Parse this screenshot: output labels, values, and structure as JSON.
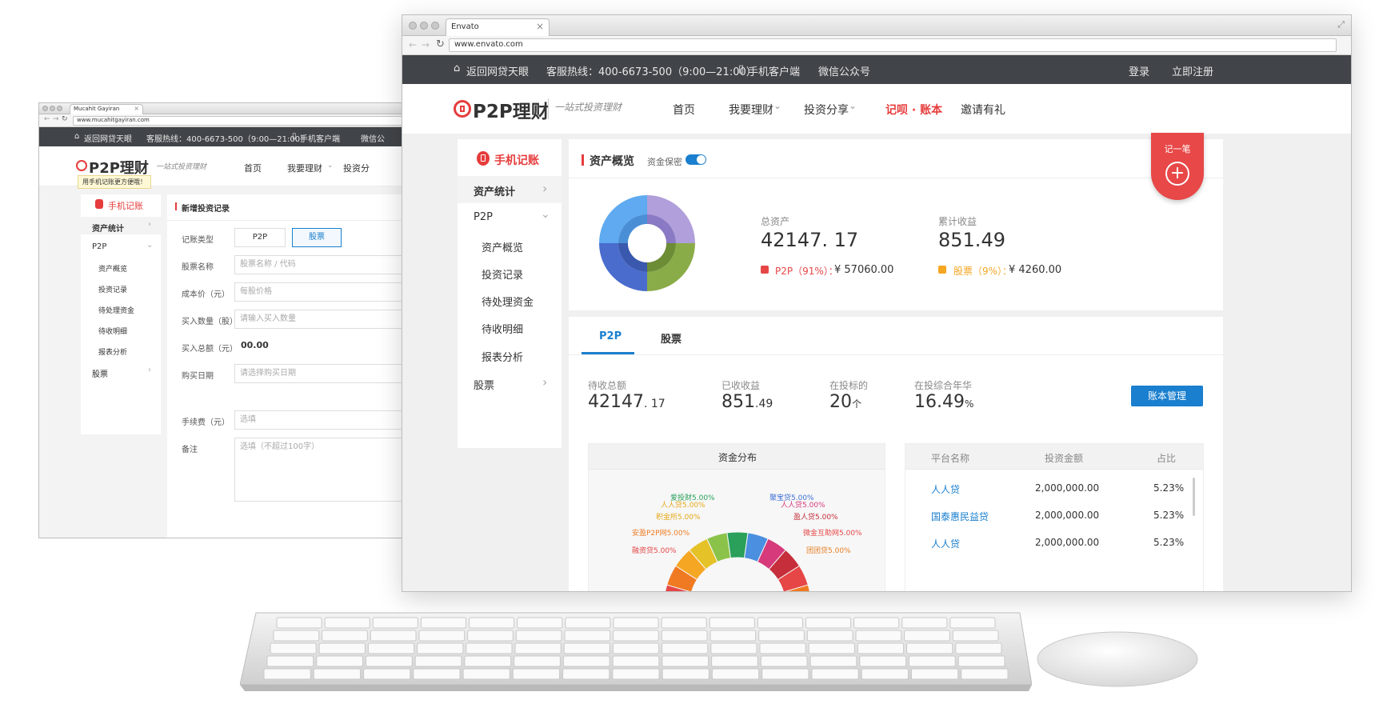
{
  "back_browser": {
    "tab_title": "Mucahit Gayiran",
    "url": "www.mucahitgayiran.com",
    "topnav": {
      "home": "返回网贷天眼",
      "hotline": "客服热线：400-6673-500（9:00—21:00）",
      "mobile": "手机客户端",
      "wechat": "微信公"
    },
    "header": {
      "logo": "P2P理财",
      "slogan": "一站式投资理财",
      "nav": [
        "首页",
        "我要理财",
        "投资分"
      ]
    },
    "tooltip": "用手机记账更方便哦！",
    "sidebar": {
      "brand": "手机记账",
      "items": [
        "资产统计",
        "P2P",
        "资产概览",
        "投资记录",
        "待处理资金",
        "待收明细",
        "报表分析",
        "股票"
      ]
    },
    "form": {
      "title": "新增投资记录",
      "type_label": "记账类型",
      "type_options": [
        "P2P",
        "股票"
      ],
      "name_label": "股票名称",
      "name_placeholder": "股票名称 / 代码",
      "cost_label": "成本价（元）",
      "cost_placeholder": "每股价格",
      "qty_label": "买入数量（股）",
      "qty_placeholder": "请输入买入数量",
      "total_label": "买入总额（元）",
      "total_value": "00.00",
      "date_label": "购买日期",
      "date_placeholder": "请选择购买日期",
      "fee_label": "手续费（元）",
      "fee_placeholder": "选填",
      "note_label": "备注",
      "note_placeholder": "选填（不超过100字）"
    }
  },
  "front_browser": {
    "tab_title": "Envato",
    "url": "www.envato.com",
    "topnav": {
      "home": "返回网贷天眼",
      "hotline": "客服热线：400-6673-500（9:00—21:00）",
      "mobile": "手机客户端",
      "wechat": "微信公众号",
      "login": "登录",
      "register": "立即注册"
    },
    "header": {
      "logo": "P2P理财",
      "slogan": "一站式投资理财",
      "nav": [
        "首页",
        "我要理财",
        "投资分享",
        "记呗 · 账本",
        "邀请有礼"
      ]
    },
    "sidebar": {
      "brand": "手机记账",
      "items": [
        "资产统计",
        "P2P",
        "资产概览",
        "投资记录",
        "待处理资金",
        "待收明细",
        "报表分析",
        "股票"
      ]
    },
    "overview": {
      "title": "资产概览",
      "privacy_label": "资金保密",
      "add_button": "记一笔",
      "total_assets_label": "总资产",
      "total_assets": "42147. 17",
      "cum_income_label": "累计收益",
      "cum_income": "851.49",
      "p2p_legend": "P2P（91%）：",
      "p2p_value": "¥ 57060.00",
      "stock_legend": "股票（9%）：",
      "stock_value": "¥ 4260.00"
    },
    "tabs": [
      "P2P",
      "股票"
    ],
    "stats": {
      "pending_label": "待收总额",
      "pending_int": "42147",
      "pending_dec": ". 17",
      "received_label": "已收收益",
      "received_int": "851",
      "received_dec": ".49",
      "investing_label": "在投标的",
      "investing_int": "20",
      "investing_unit": "个",
      "rate_label": "在投综合年华",
      "rate_int": "16.49",
      "rate_unit": "%",
      "manage_button": "账本管理"
    },
    "distribution": {
      "title": "资金分布",
      "labels": [
        "爱投财5.00%",
        "人人贷5.00%",
        "积金所5.00%",
        "安盈P2P网5.00%",
        "融资贷5.00%",
        "聚宝贷5.00%",
        "人人贷5.00%",
        "盈人贷5.00%",
        "微金互助网5.00%",
        "团团贷5.00%"
      ]
    },
    "table": {
      "headers": [
        "平台名称",
        "投资金额",
        "占比"
      ],
      "rows": [
        [
          "人人贷",
          "2,000,000.00",
          "5.23%"
        ],
        [
          "国泰惠民益贷",
          "2,000,000.00",
          "5.23%"
        ],
        [
          "人人贷",
          "2,000,000.00",
          "5.23%"
        ]
      ]
    }
  },
  "chart_data": {
    "type": "pie",
    "categories": [
      "P2P",
      "股票"
    ],
    "values": [
      91,
      9
    ],
    "title": ""
  },
  "colors": {
    "accent_red": "#e63c3c",
    "accent_blue": "#1a7fce",
    "topnav_bg": "#414448"
  }
}
